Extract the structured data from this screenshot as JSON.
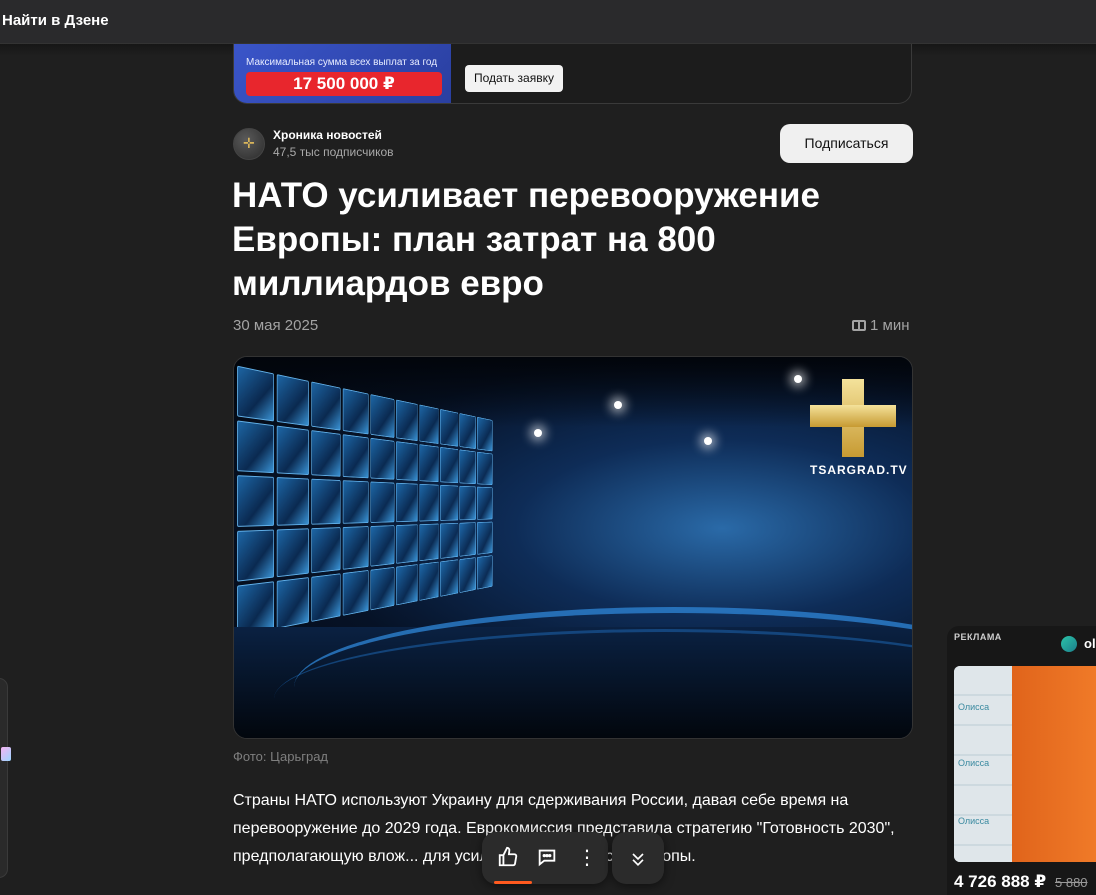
{
  "topbar": {
    "title": "Найти в Дзене"
  },
  "banner": {
    "caption": "Максимальная сумма всех выплат за год",
    "amount": "17 500 000 ₽",
    "apply_label": "Подать заявку"
  },
  "channel": {
    "name": "Хроника новостей",
    "subscribers": "47,5 тыс подписчиков",
    "subscribe_label": "Подписаться"
  },
  "article": {
    "headline": "НАТО усиливает перевооружение Европы: план затрат на 800 миллиардов евро",
    "date": "30 мая 2025",
    "read_time": "1 мин",
    "image_logo_text": "TSARGRAD.TV",
    "photo_caption": "Фото: Царьград",
    "body": "Страны НАТО используют Украину для сдерживания России, давая себе время на перевооружение до 2029 года. Еврокомиссия представила стратегию \"Готовность 2030\", предполагающую влож... для усиления безопасности Европы."
  },
  "actions": {
    "like_icon": "thumbs-up-icon",
    "comment_icon": "comment-icon",
    "more_icon": "more-vertical-icon",
    "scroll_icon": "chevron-double-down-icon"
  },
  "side_ad": {
    "label": "РЕКЛАМА",
    "brand": "ol",
    "price": "4 726 888 ₽",
    "old_price": "5 880",
    "pack_text": "Олисса"
  },
  "colors": {
    "background": "#1f1f1f",
    "accent": "#ff5a1f",
    "banner_blue": "#3a55c9",
    "banner_red": "#e8262d"
  }
}
